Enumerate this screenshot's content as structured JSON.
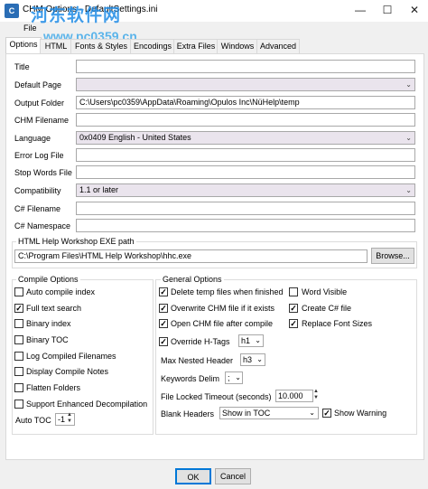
{
  "window": {
    "title": "CHM Options - DefaultSettings.ini",
    "menu": "File",
    "minimize": "—",
    "maximize": "☐",
    "close": "✕"
  },
  "watermark": {
    "line1": "河东软件网",
    "line2": "www.pc0359.cn"
  },
  "tabs": [
    "Options",
    "HTML",
    "Fonts & Styles",
    "Encodings",
    "Extra Files",
    "Windows",
    "Advanced"
  ],
  "fields": {
    "title": {
      "label": "Title",
      "value": ""
    },
    "default_page": {
      "label": "Default Page",
      "value": ""
    },
    "output_folder": {
      "label": "Output Folder",
      "value": "C:\\Users\\pc0359\\AppData\\Roaming\\Opulos Inc\\NüHelp\\temp"
    },
    "chm_filename": {
      "label": "CHM Filename",
      "value": ""
    },
    "language": {
      "label": "Language",
      "value": "0x0409 English - United States"
    },
    "error_log": {
      "label": "Error Log File",
      "value": ""
    },
    "stop_words": {
      "label": "Stop Words File",
      "value": ""
    },
    "compatibility": {
      "label": "Compatibility",
      "value": "1.1 or later"
    },
    "cs_filename": {
      "label": "C# Filename",
      "value": ""
    },
    "cs_namespace": {
      "label": "C# Namespace",
      "value": ""
    }
  },
  "hhw": {
    "group_label": "HTML Help Workshop EXE path",
    "path": "C:\\Program Files\\HTML Help Workshop\\hhc.exe",
    "browse": "Browse..."
  },
  "compile": {
    "group_label": "Compile Options",
    "items": [
      {
        "label": "Auto compile index",
        "checked": false
      },
      {
        "label": "Full text search",
        "checked": true
      },
      {
        "label": "Binary index",
        "checked": false
      },
      {
        "label": "Binary TOC",
        "checked": false
      },
      {
        "label": "Log Compiled Filenames",
        "checked": false
      },
      {
        "label": "Display Compile Notes",
        "checked": false
      },
      {
        "label": "Flatten Folders",
        "checked": false
      },
      {
        "label": "Support Enhanced Decompilation",
        "checked": false
      }
    ],
    "auto_toc_label": "Auto TOC",
    "auto_toc_value": "-1"
  },
  "general": {
    "group_label": "General Options",
    "left": [
      {
        "label": "Delete temp files when finished",
        "checked": true
      },
      {
        "label": "Overwrite CHM file if it exists",
        "checked": true
      },
      {
        "label": "Open CHM file after compile",
        "checked": true
      },
      {
        "label": "Override H-Tags",
        "checked": true
      }
    ],
    "right": [
      {
        "label": "Word Visible",
        "checked": false
      },
      {
        "label": "Create C# file",
        "checked": true
      },
      {
        "label": "Replace Font Sizes",
        "checked": true
      }
    ],
    "htags_value": "h1",
    "max_nested_label": "Max Nested Header",
    "max_nested_value": "h3",
    "keywords_label": "Keywords Delim",
    "keywords_value": ";",
    "timeout_label": "File Locked Timeout (seconds)",
    "timeout_value": "10.000",
    "blank_headers_label": "Blank Headers",
    "blank_headers_value": "Show in TOC",
    "show_warning": {
      "label": "Show Warning",
      "checked": true
    }
  },
  "footer": {
    "ok": "OK",
    "cancel": "Cancel"
  }
}
